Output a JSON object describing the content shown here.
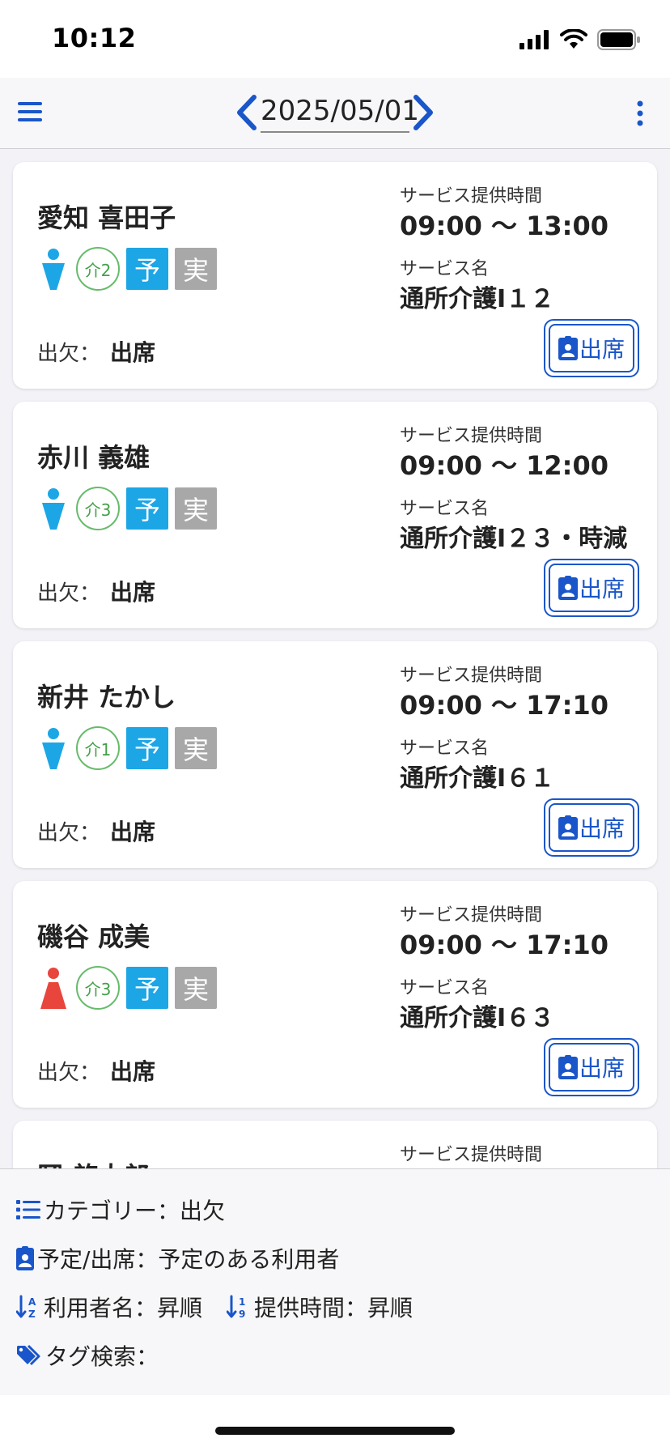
{
  "status_bar": {
    "time": "10:12"
  },
  "header": {
    "date": "2025/05/01"
  },
  "cards": [
    {
      "name": "愛知 喜田子",
      "gender": "male",
      "care_level": "介2",
      "yotei": "予",
      "jisseki": "実",
      "attendance_label": "出欠：",
      "attendance": "出席",
      "service_time_label": "サービス提供時間",
      "service_time": "09:00 〜 13:00",
      "service_name_label": "サービス名",
      "service_name": "通所介護I１２",
      "attend_button": "出席"
    },
    {
      "name": "赤川 義雄",
      "gender": "male",
      "care_level": "介3",
      "yotei": "予",
      "jisseki": "実",
      "attendance_label": "出欠：",
      "attendance": "出席",
      "service_time_label": "サービス提供時間",
      "service_time": "09:00 〜 12:00",
      "service_name_label": "サービス名",
      "service_name": "通所介護I２３・時減",
      "attend_button": "出席"
    },
    {
      "name": "新井 たかし",
      "gender": "male",
      "care_level": "介1",
      "yotei": "予",
      "jisseki": "実",
      "attendance_label": "出欠：",
      "attendance": "出席",
      "service_time_label": "サービス提供時間",
      "service_time": "09:00 〜 17:10",
      "service_name_label": "サービス名",
      "service_name": "通所介護I６１",
      "attend_button": "出席"
    },
    {
      "name": "磯谷 成美",
      "gender": "female",
      "care_level": "介3",
      "yotei": "予",
      "jisseki": "実",
      "attendance_label": "出欠：",
      "attendance": "出席",
      "service_time_label": "サービス提供時間",
      "service_time": "09:00 〜 17:10",
      "service_name_label": "サービス名",
      "service_name": "通所介護I６３",
      "attend_button": "出席"
    },
    {
      "name": "岡 啓太郎",
      "service_time_label": "サービス提供時間"
    }
  ],
  "footer": {
    "category": "カテゴリー：出欠",
    "schedule": "予定/出席：予定のある利用者",
    "sort_name": "利用者名：昇順",
    "sort_time": "提供時間：昇順",
    "tag_search": "タグ検索："
  },
  "colors": {
    "accent": "#1a56c9",
    "yotei": "#1ca6e6",
    "jisseki": "#a8a8a8",
    "care": "#43a047",
    "male": "#1ca6e6",
    "female": "#e8453c"
  }
}
